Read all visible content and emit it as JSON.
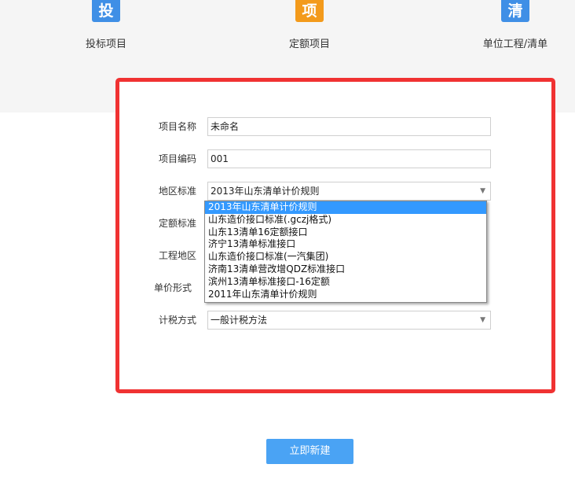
{
  "project_types": [
    {
      "label": "投标项目",
      "icon_text": "投",
      "icon": "bid-icon",
      "color": "#3f8fe6"
    },
    {
      "label": "定额项目",
      "icon_text": "项",
      "icon": "quota-icon",
      "color": "#f39a1b"
    },
    {
      "label": "单位工程/清单",
      "icon_text": "清",
      "icon": "bill-icon",
      "color": "#3f8fe6"
    }
  ],
  "form": {
    "project_name": {
      "label": "项目名称",
      "value": "未命名"
    },
    "project_code": {
      "label": "项目编码",
      "value": "001"
    },
    "region_standard": {
      "label": "地区标准",
      "value": "2013年山东清单计价规则"
    },
    "quota_standard": {
      "label": "定额标准"
    },
    "project_region": {
      "label": "工程地区"
    },
    "unit_price_form": {
      "label": "单价形式"
    },
    "tax_method": {
      "label": "计税方式",
      "value": "一般计税方法"
    }
  },
  "dropdown": {
    "options": [
      "2013年山东清单计价规则",
      "山东造价接口标准(.gczj格式)",
      "山东13清单16定额接口",
      "济宁13清单标准接口",
      "山东造价接口标准(一汽集团)",
      "济南13清单营改增QDZ标准接口",
      "滨州13清单标准接口-16定额",
      "2011年山东清单计价规则"
    ],
    "selected_index": 0
  },
  "create_button": {
    "label": "立即新建"
  },
  "colors": {
    "accent": "#4aa3f4",
    "highlight_frame": "#f03232",
    "selected": "#3399ff"
  }
}
